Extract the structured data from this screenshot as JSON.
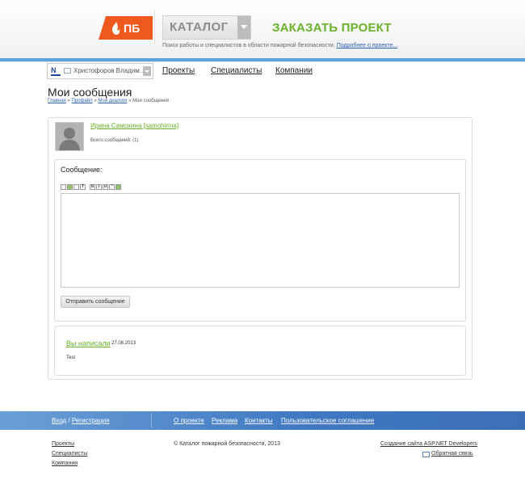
{
  "header": {
    "logo_text": "ПБ",
    "catalog_label": "КАТАЛОГ",
    "order_link": "ЗАКАЗАТЬ ПРОЕКТ",
    "tagline": "Поиск работы и специалистов в области пожарной безопасности.",
    "tagline_link": "Подробнее о проекте..."
  },
  "nav": {
    "user_name": "Христофоров Владим...",
    "links": [
      "Проекты",
      "Специалисты",
      "Компании"
    ]
  },
  "page": {
    "title": "Мои сообщения",
    "breadcrumb": [
      "Главная",
      "Профайл",
      "Мои диалоги",
      "Мои сообщения"
    ],
    "breadcrumb_sep": "»"
  },
  "dialog": {
    "contact_name": "Ирина Самохина [samohirina]",
    "total_messages": "Всего сообщений: (1)",
    "compose_label": "Сообщение:",
    "message_value": "",
    "send_button": "Отправить сообщение",
    "toolbar_icons": [
      "link-icon",
      "image-icon",
      "list-icon",
      "text-icon",
      "bold-icon",
      "italic-icon",
      "underline-icon",
      "quote-icon",
      "table-icon"
    ],
    "toolbar_glyphs": [
      "",
      "",
      "",
      "T",
      "b",
      "i",
      "u",
      "\"",
      ""
    ]
  },
  "history": {
    "author": "Вы написали",
    "date": "27.08.2013",
    "text": "Test"
  },
  "footer": {
    "login": "Вход",
    "slash": "/",
    "register": "Регистрация",
    "links": [
      "О проекте",
      "Реклама",
      "Контакты",
      "Пользовательское соглашение"
    ],
    "left_links": [
      "Проекты",
      "Специалисты",
      "Компании"
    ],
    "copyright": "© Каталог пожарной безопасности, 2013",
    "developer": "Создание сайта ASP.NET Developers",
    "feedback": "Обратная связь"
  },
  "colors": {
    "accent_green": "#6ab22b",
    "logo_orange": "#ee5a1e",
    "footer_blue": "#3f78c1",
    "header_line": "#5ea3dd"
  }
}
